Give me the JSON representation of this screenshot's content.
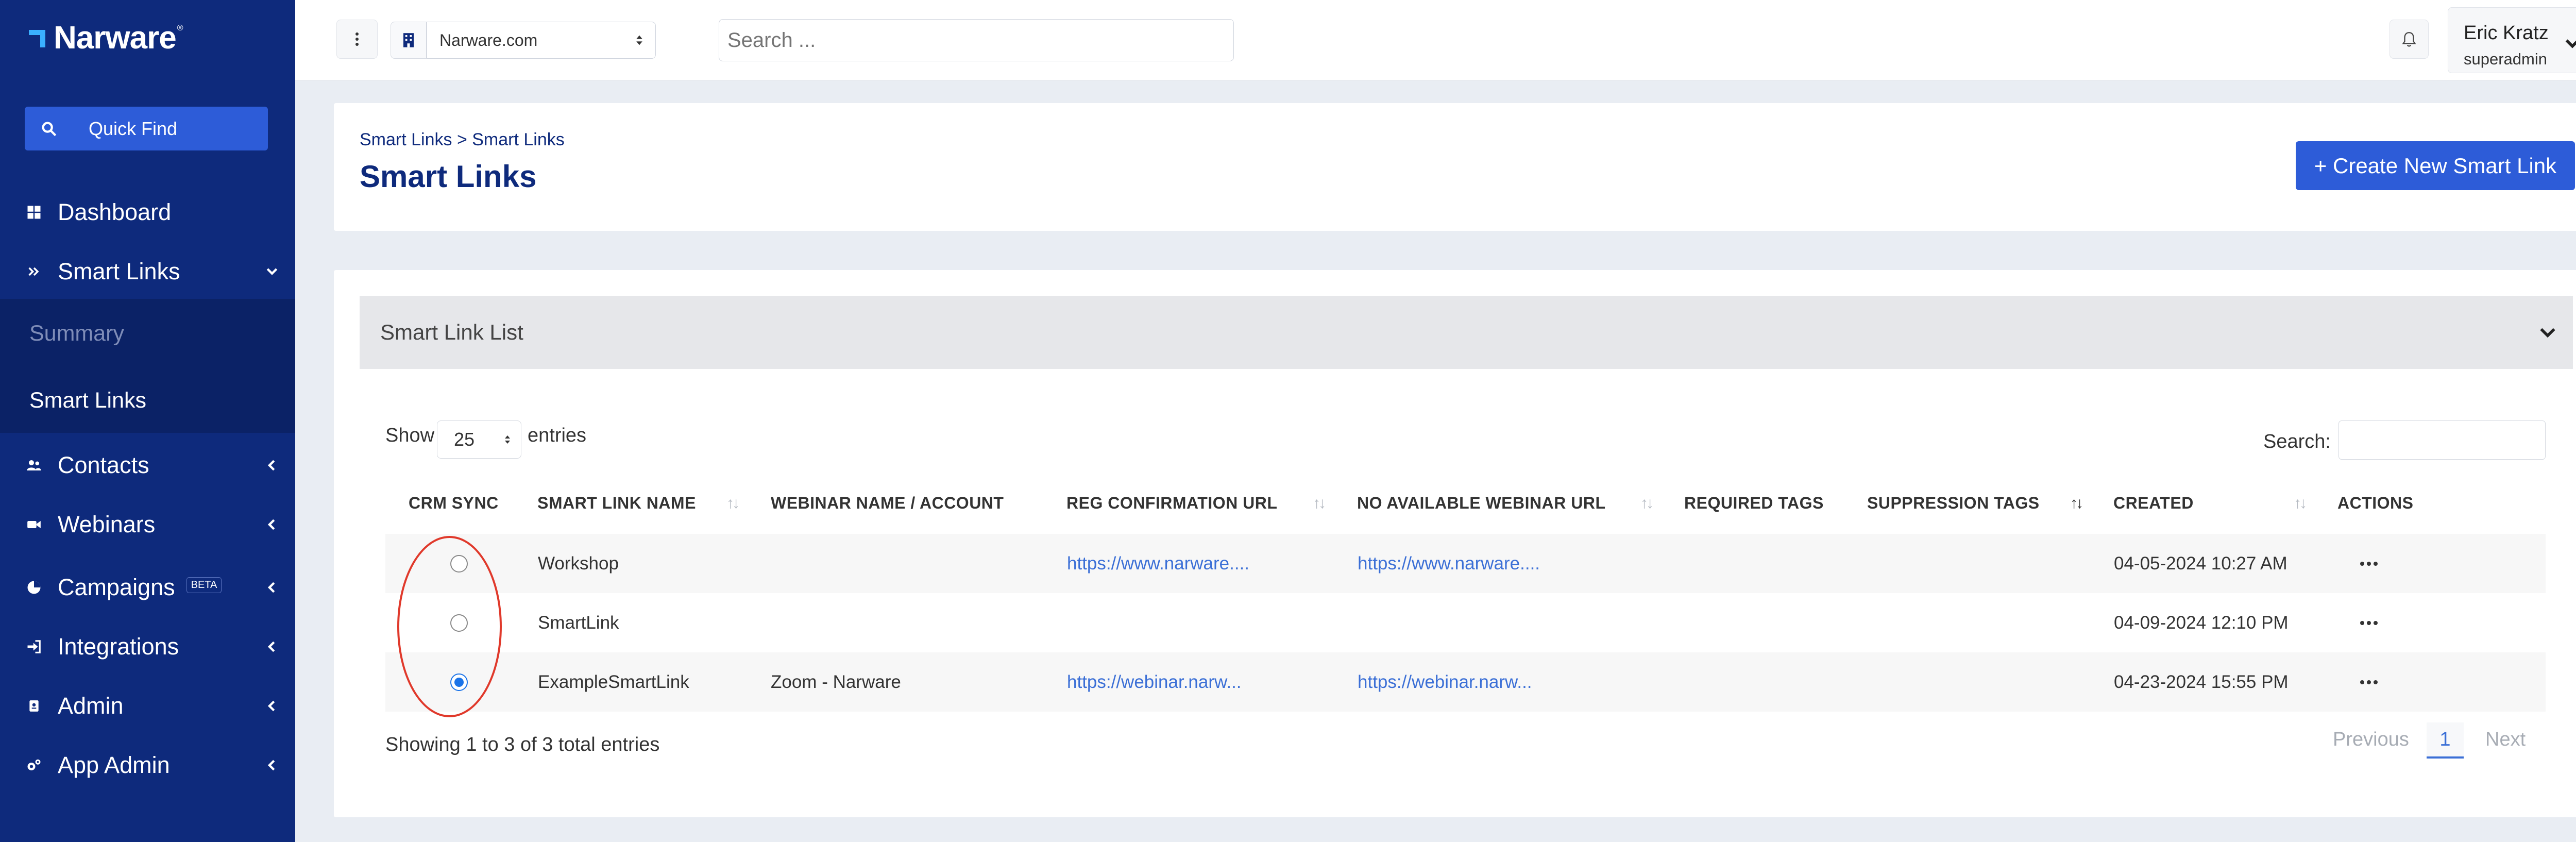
{
  "app": {
    "brand": "Narware",
    "trademark": "®",
    "quick_find_label": "Quick Find"
  },
  "sidebar": {
    "items": [
      {
        "label": "Dashboard",
        "icon": "dashboard-icon"
      },
      {
        "label": "Smart Links",
        "icon": "double-chevron-icon",
        "expanded": true
      },
      {
        "label": "Contacts",
        "icon": "users-icon"
      },
      {
        "label": "Webinars",
        "icon": "video-icon"
      },
      {
        "label": "Campaigns",
        "icon": "chart-icon",
        "badge": "BETA"
      },
      {
        "label": "Integrations",
        "icon": "sign-in-icon"
      },
      {
        "label": "Admin",
        "icon": "id-badge-icon"
      },
      {
        "label": "App Admin",
        "icon": "cogs-icon"
      }
    ],
    "subitems": [
      {
        "label": "Summary",
        "active": false
      },
      {
        "label": "Smart Links",
        "active": true
      }
    ]
  },
  "header": {
    "site_value": "Narware.com",
    "search_placeholder": "Search ...",
    "user_name": "Eric Kratz",
    "user_role": "superadmin"
  },
  "page": {
    "breadcrumb": "Smart Links > Smart Links",
    "title": "Smart Links",
    "create_label": "+ Create New Smart Link"
  },
  "list": {
    "panel_title": "Smart Link List",
    "show_label": "Show",
    "page_length": "25",
    "entries_label": "entries",
    "search_label": "Search:",
    "columns": [
      "CRM SYNC",
      "SMART LINK NAME",
      "WEBINAR NAME / ACCOUNT",
      "REG CONFIRMATION URL",
      "NO AVAILABLE WEBINAR URL",
      "REQUIRED TAGS",
      "SUPPRESSION TAGS",
      "CREATED",
      "ACTIONS"
    ],
    "rows": [
      {
        "crm_sync": false,
        "name": "Workshop",
        "webinar": "",
        "reg_url": "https://www.narware....",
        "no_webinar_url": "https://www.narware....",
        "required_tags": "",
        "suppression_tags": "",
        "created": "04-05-2024 10:27 AM"
      },
      {
        "crm_sync": false,
        "name": "SmartLink",
        "webinar": "",
        "reg_url": "",
        "no_webinar_url": "",
        "required_tags": "",
        "suppression_tags": "",
        "created": "04-09-2024 12:10 PM"
      },
      {
        "crm_sync": true,
        "name": "ExampleSmartLink",
        "webinar": "Zoom - Narware",
        "reg_url": "https://webinar.narw...",
        "no_webinar_url": "https://webinar.narw...",
        "required_tags": "",
        "suppression_tags": "",
        "created": "04-23-2024 15:55 PM"
      }
    ],
    "info": "Showing 1 to 3 of 3 total entries",
    "pagination": {
      "previous": "Previous",
      "current": "1",
      "next": "Next"
    }
  },
  "colors": {
    "sidebar": "#0e2a7c",
    "accent": "#2d5cd8",
    "link": "#3b6fd6",
    "annotation": "#e0392b"
  }
}
